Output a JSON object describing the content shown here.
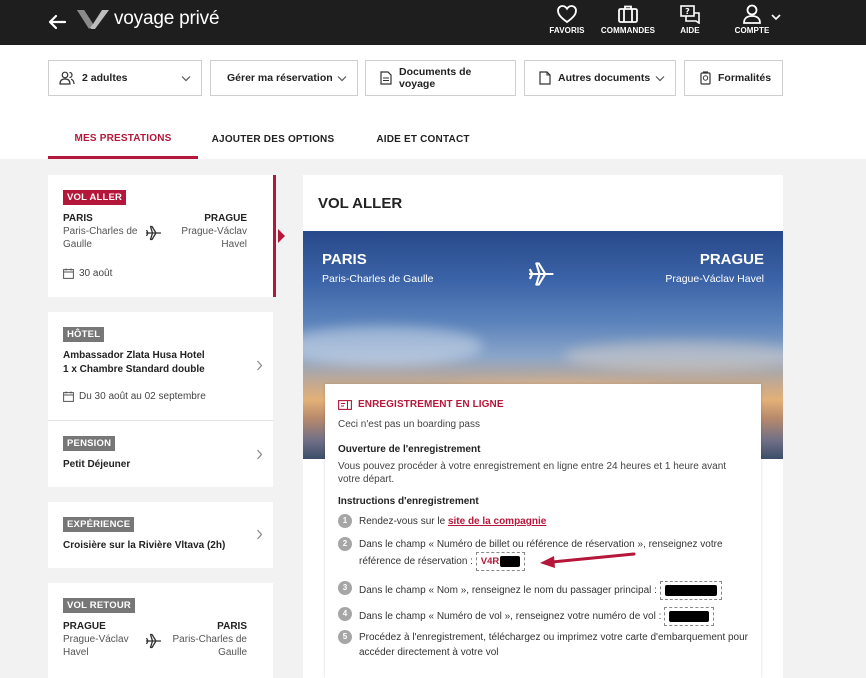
{
  "topbar": {
    "brand": "voyage privé",
    "nav": {
      "favoris": "FAVORIS",
      "commandes": "COMMANDES",
      "aide": "AIDE",
      "compte": "COMPTE"
    }
  },
  "toolbar": {
    "adults": "2 adultes",
    "manage": "Gérer ma réservation",
    "documents": "Documents de voyage",
    "other_docs": "Autres documents",
    "formalities": "Formalités"
  },
  "tabs": [
    {
      "label": "MES PRESTATIONS",
      "active": true
    },
    {
      "label": "AJOUTER DES OPTIONS",
      "active": false
    },
    {
      "label": "AIDE ET CONTACT",
      "active": false
    }
  ],
  "sidebar": {
    "vol_aller": {
      "tag": "VOL ALLER",
      "from_city": "PARIS",
      "from_airport": "Paris-Charles de Gaulle",
      "to_city": "PRAGUE",
      "to_airport": "Prague-Václav Havel",
      "date": "30 août"
    },
    "hotel": {
      "tag": "HÔTEL",
      "name": "Ambassador Zlata Husa Hotel",
      "room": "1 x Chambre Standard double",
      "dates": "Du 30 août au 02 septembre"
    },
    "pension": {
      "tag": "PENSION",
      "value": "Petit Déjeuner"
    },
    "experience": {
      "tag": "EXPÉRIENCE",
      "value": "Croisière sur la Rivière Vltava (2h)"
    },
    "vol_retour": {
      "tag": "VOL RETOUR",
      "from_city": "PRAGUE",
      "from_airport": "Prague-Václav Havel",
      "to_city": "PARIS",
      "to_airport": "Paris-Charles de Gaulle"
    }
  },
  "main": {
    "title": "VOL ALLER",
    "hero": {
      "from_city": "PARIS",
      "from_airport": "Paris-Charles de Gaulle",
      "to_city": "PRAGUE",
      "to_airport": "Prague-Václav Havel"
    },
    "checkin": {
      "heading": "ENREGISTREMENT EN LIGNE",
      "sub": "Ceci n'est pas un boarding pass",
      "opening_title": "Ouverture de l'enregistrement",
      "opening_text": "Vous pouvez procéder à votre enregistrement en ligne entre 24 heures et 1 heure avant votre départ.",
      "instructions_title": "Instructions d'enregistrement",
      "steps": [
        {
          "n": "1",
          "text": "Rendez-vous sur le ",
          "link": "site de la compagnie"
        },
        {
          "n": "2",
          "text": "Dans le champ « Numéro de billet ou référence de réservation », renseignez votre référence de réservation :",
          "ref": "V4R"
        },
        {
          "n": "3",
          "text": "Dans le champ « Nom », renseignez le nom du passager principal :"
        },
        {
          "n": "4",
          "text": "Dans le champ « Numéro de vol », renseignez votre numéro de vol :"
        },
        {
          "n": "5",
          "text": "Procédez à l'enregistrement, téléchargez ou imprimez votre carte d'embarquement pour accéder directement à votre vol"
        }
      ]
    }
  },
  "colors": {
    "accent": "#b5173a",
    "topbar": "#1e1e1e",
    "background": "#f2f2f2"
  }
}
